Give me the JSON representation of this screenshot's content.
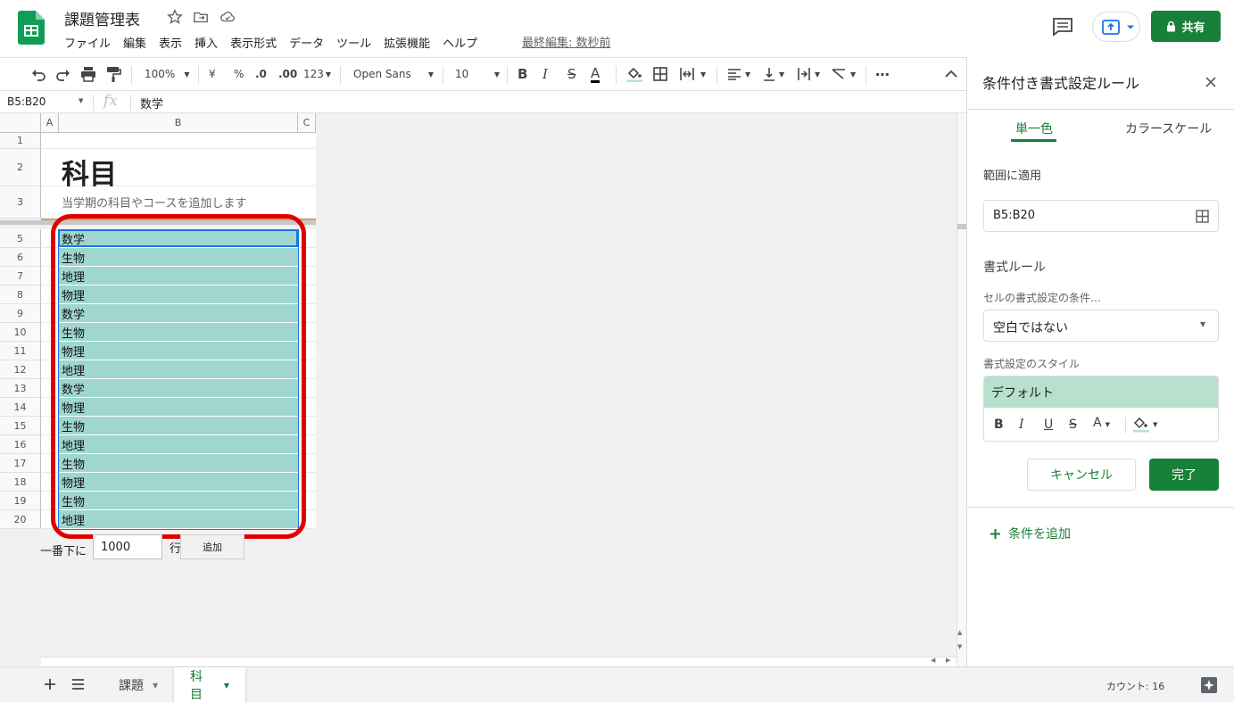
{
  "app": {
    "title": "課題管理表",
    "menus": [
      "ファイル",
      "編集",
      "表示",
      "挿入",
      "表示形式",
      "データ",
      "ツール",
      "拡張機能",
      "ヘルプ"
    ],
    "last_edit": "最終編集: 数秒前",
    "share_label": "共有",
    "brand_color": "#188038"
  },
  "toolbar": {
    "zoom": "100%",
    "currency": "¥",
    "percent": "%",
    "dec_decrease": ".0",
    "dec_increase": ".00",
    "number_format": "123",
    "font": "Open Sans",
    "font_size": "10",
    "bold": "B",
    "italic": "I",
    "strike": "S",
    "text_color": "A",
    "more": "⋯"
  },
  "formula_bar": {
    "name_box": "B5:B20",
    "fx": "fx",
    "value": "数学"
  },
  "grid": {
    "col_headers": [
      "A",
      "B",
      "C"
    ],
    "title": "科目",
    "subtitle": "当学期の科目やコースを追加します",
    "rows": [
      {
        "num": "5",
        "value": "数学"
      },
      {
        "num": "6",
        "value": "生物"
      },
      {
        "num": "7",
        "value": "地理"
      },
      {
        "num": "8",
        "value": "物理"
      },
      {
        "num": "9",
        "value": "数学"
      },
      {
        "num": "10",
        "value": "生物"
      },
      {
        "num": "11",
        "value": "物理"
      },
      {
        "num": "12",
        "value": "地理"
      },
      {
        "num": "13",
        "value": "数学"
      },
      {
        "num": "14",
        "value": "物理"
      },
      {
        "num": "15",
        "value": "生物"
      },
      {
        "num": "16",
        "value": "地理"
      },
      {
        "num": "17",
        "value": "生物"
      },
      {
        "num": "18",
        "value": "物理"
      },
      {
        "num": "19",
        "value": "生物"
      },
      {
        "num": "20",
        "value": "地理"
      }
    ],
    "fill_color": "#9fd6d0",
    "add_rows": {
      "prefix": "一番下に",
      "count": "1000",
      "suffix": "行",
      "button": "追加"
    }
  },
  "sidebar": {
    "title": "条件付き書式設定ルール",
    "tabs": [
      "単一色",
      "カラースケール"
    ],
    "range_label": "範囲に適用",
    "range_value": "B5:B20",
    "rules_heading": "書式ルール",
    "condition_label": "セルの書式設定の条件…",
    "condition_value": "空白ではない",
    "style_label": "書式設定のスタイル",
    "style_preview": "デフォルト",
    "style_color": "#b7e1cd",
    "style_tools": [
      "B",
      "I",
      "U",
      "S",
      "A"
    ],
    "cancel": "キャンセル",
    "done": "完了",
    "add_condition": "条件を追加"
  },
  "bottom": {
    "sheets": [
      "課題",
      "科目"
    ],
    "active_sheet": "科目",
    "status": "カウント: 16"
  }
}
